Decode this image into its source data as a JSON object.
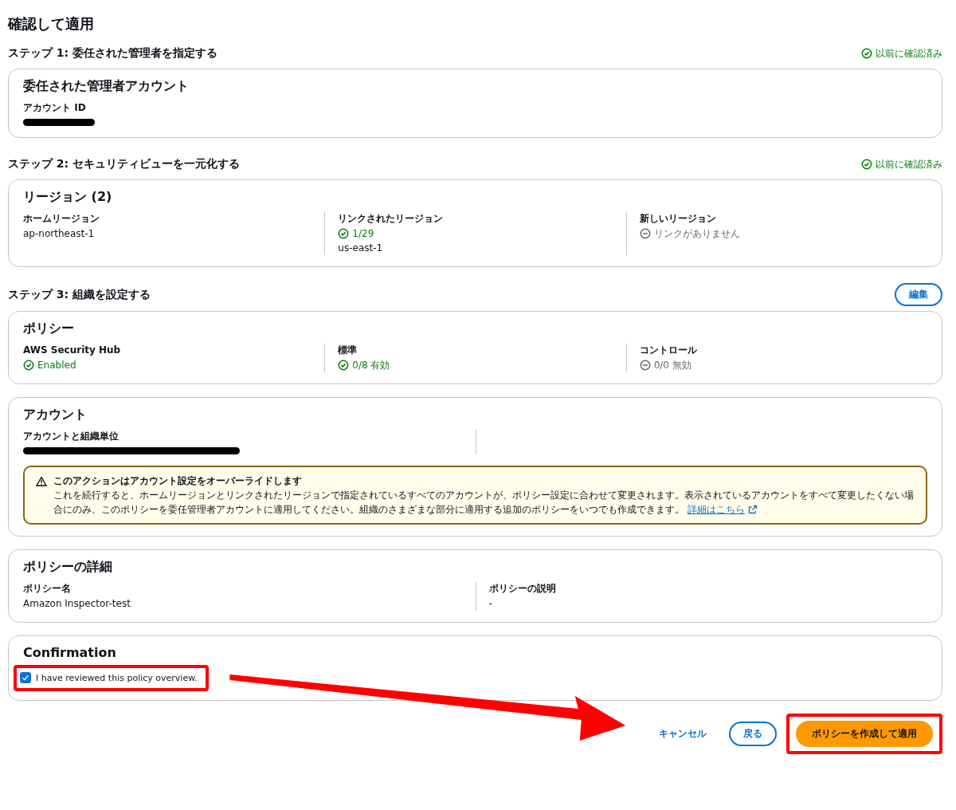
{
  "page_title": "確認して適用",
  "steps": [
    {
      "title": "ステップ 1: 委任された管理者を指定する",
      "status": {
        "kind": "success",
        "text": "以前に確認済み"
      },
      "cards": [
        {
          "title": "委任された管理者アカウント",
          "kind": "fields",
          "columns": [
            {
              "label": "アカウント ID",
              "items": [
                {
                  "kind": "mask"
                }
              ]
            }
          ]
        }
      ]
    },
    {
      "title": "ステップ 2: セキュリティビューを一元化する",
      "status": {
        "kind": "success",
        "text": "以前に確認済み"
      },
      "cards": [
        {
          "title": "リージョン (2)",
          "kind": "fields",
          "columns": [
            {
              "label": "ホームリージョン",
              "items": [
                {
                  "kind": "text",
                  "text": "ap-northeast-1"
                }
              ]
            },
            {
              "label": "リンクされたリージョン",
              "items": [
                {
                  "kind": "success",
                  "text": "1/29"
                },
                {
                  "kind": "text",
                  "text": "us-east-1"
                }
              ]
            },
            {
              "label": "新しいリージョン",
              "items": [
                {
                  "kind": "neutral",
                  "text": "リンクがありません"
                }
              ]
            }
          ]
        }
      ]
    },
    {
      "title": "ステップ 3: 組織を設定する",
      "action": {
        "label": "編集"
      },
      "cards": [
        {
          "title": "ポリシー",
          "kind": "fields",
          "columns": [
            {
              "label": "AWS Security Hub",
              "items": [
                {
                  "kind": "success",
                  "text": "Enabled"
                }
              ]
            },
            {
              "label": "標準",
              "items": [
                {
                  "kind": "success",
                  "text": "0/8 有効"
                }
              ]
            },
            {
              "label": "コントロール",
              "items": [
                {
                  "kind": "neutral",
                  "text": "0/0 無効"
                }
              ]
            }
          ]
        },
        {
          "title": "アカウント",
          "kind": "split",
          "columns": [
            {
              "label": "アカウントと組織単位",
              "items": [
                {
                  "kind": "longmask"
                }
              ]
            }
          ],
          "alert": {
            "kind": "warning",
            "title": "このアクションはアカウント設定をオーバーライドします",
            "text": "これを続行すると、ホームリージョンとリンクされたリージョンで指定されているすべてのアカウントが、ポリシー設定に合わせて変更されます。表示されているアカウントをすべて変更したくない場合にのみ、このポリシーを委任管理者アカウントに適用してください。組織のさまざまな部分に適用する追加のポリシーをいつでも作成できます。",
            "link": "詳細はこちら"
          }
        },
        {
          "title": "ポリシーの詳細",
          "kind": "fields",
          "columns": [
            {
              "label": "ポリシー名",
              "items": [
                {
                  "kind": "text",
                  "text": "Amazon Inspector-test"
                }
              ]
            },
            {
              "label": "ポリシーの説明",
              "items": [
                {
                  "kind": "text",
                  "text": "-"
                }
              ]
            }
          ]
        }
      ]
    }
  ],
  "confirmation": {
    "title": "Confirmation",
    "checkbox": {
      "label": "I have reviewed this policy overview.",
      "checked": true
    }
  },
  "buttons": [
    {
      "kind": "link",
      "label": "キャンセル"
    },
    {
      "kind": "secondary",
      "label": "戻る"
    },
    {
      "kind": "primary",
      "label": "ポリシーを作成して適用"
    }
  ]
}
